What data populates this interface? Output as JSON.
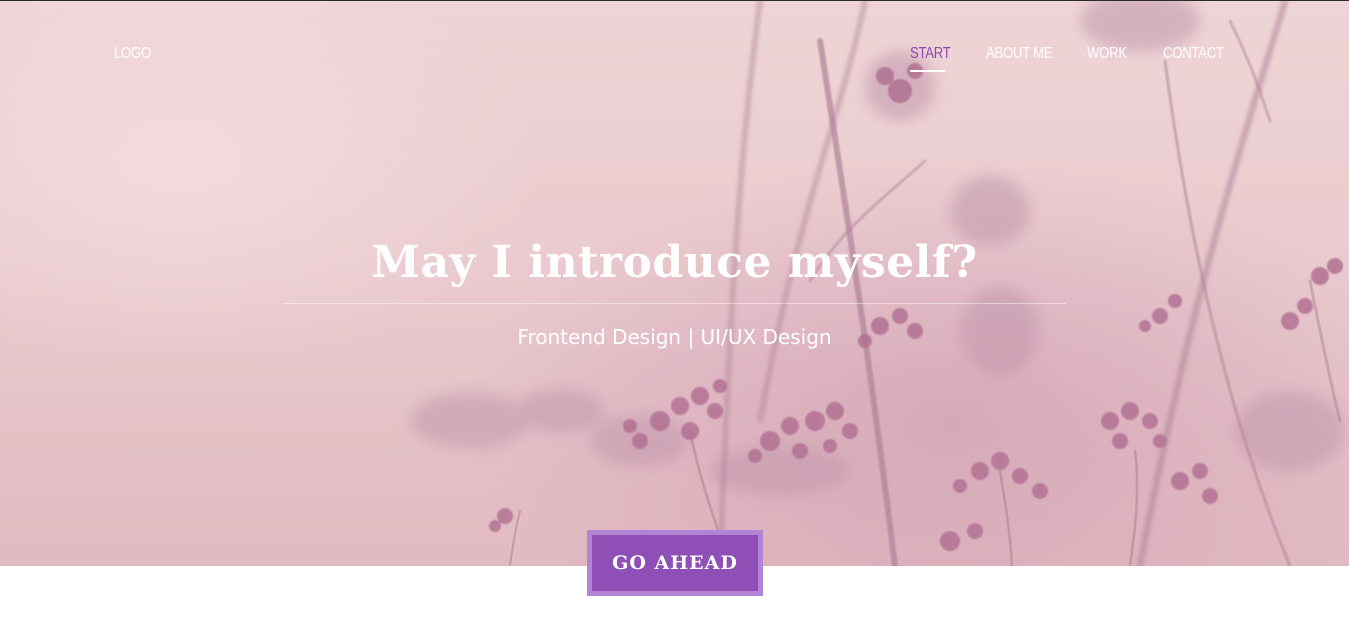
{
  "header": {
    "logo_text": "LOGO",
    "nav": [
      {
        "label": "START",
        "active": true
      },
      {
        "label": "ABOUT ME",
        "active": false
      },
      {
        "label": "WORK",
        "active": false
      },
      {
        "label": "CONTACT",
        "active": false
      }
    ]
  },
  "hero": {
    "title": "May I introduce myself?",
    "subtitle": "Frontend Design | UI/UX Design",
    "background": "pink-flower-photo",
    "cta_label": "GO AHEAD"
  },
  "colors": {
    "accent": "#8e4fb6",
    "accent_border": "#b184d6",
    "hero_tint": "#e9c8cc",
    "text": "#ffffff"
  }
}
